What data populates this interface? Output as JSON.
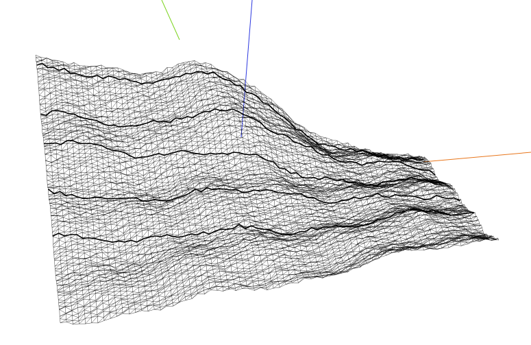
{
  "scene": {
    "background": "#ffffff",
    "mesh_color": "#000000",
    "axes": {
      "x": {
        "name": "x-axis",
        "color": "#e8751a"
      },
      "y": {
        "name": "y-axis",
        "color": "#7ad31c"
      },
      "z": {
        "name": "z-axis",
        "color": "#2a36e0"
      }
    },
    "mesh": {
      "name": "terrain-wireframe",
      "style": "triangulated wireframe"
    }
  }
}
